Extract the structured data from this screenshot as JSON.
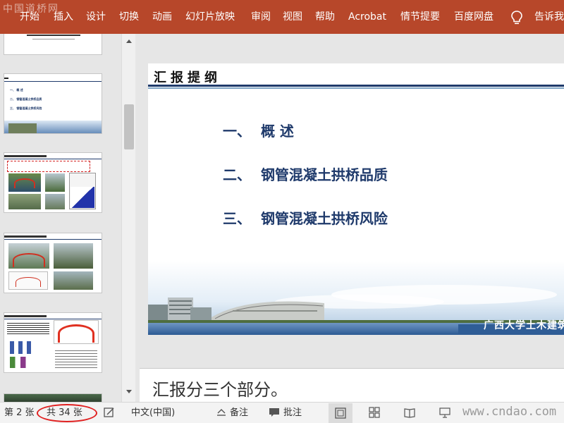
{
  "ribbon": {
    "watermark": "中国道桥网",
    "tabs": [
      "开始",
      "插入",
      "设计",
      "切换",
      "动画",
      "幻灯片放映",
      "审阅",
      "视图",
      "帮助",
      "Acrobat",
      "情节提要",
      "百度网盘"
    ],
    "tell_me": "告诉我",
    "color": "#b7472a"
  },
  "slide": {
    "title": "汇报提纲",
    "outline": [
      {
        "num": "一、",
        "text": "概  述"
      },
      {
        "num": "二、",
        "text": "钢管混凝土拱桥品质"
      },
      {
        "num": "三、",
        "text": "钢管混凝土拱桥风险"
      }
    ],
    "footer": "广西大学土木建筑",
    "title_color": "#1f3a6b"
  },
  "notes": "汇报分三个部分。",
  "thumbnails": {
    "slide2_items": [
      "一、 概 述",
      "二、 钢管混凝土拱桥品质",
      "三、 钢管混凝土拱桥风险"
    ]
  },
  "status": {
    "slide_no": "第 2 张",
    "total": "共 34 张",
    "language": "中文(中国)",
    "notes_btn": "备注",
    "comments_btn": "批注",
    "site": "www.cndao.com"
  }
}
